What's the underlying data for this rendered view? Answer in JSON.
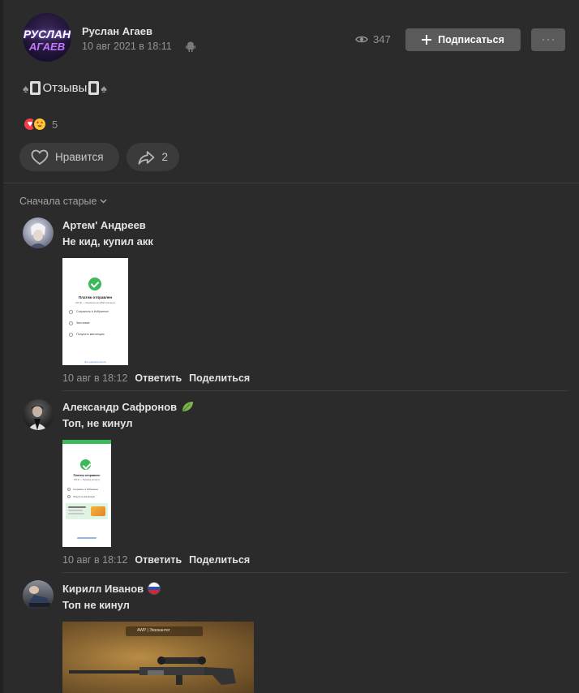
{
  "post": {
    "author": "Руслан Агаев",
    "avatar_text_top": "РУСЛАН",
    "avatar_text_bottom": "АГАЕВ",
    "date": "10 авг 2021 в 18:11",
    "views": "347",
    "subscribe_label": "Подписаться",
    "text": "Отзывы",
    "reaction_count": "5",
    "like_label": "Нравится",
    "share_count": "2"
  },
  "sort": {
    "label": "Сначала старые"
  },
  "comments": [
    {
      "author": "Артем' Андреев",
      "text": "Не кид, купил акк",
      "time": "10 авг в 18:12",
      "reply_label": "Ответить",
      "share_label": "Поделиться",
      "shot_title": "Платеж отправлен",
      "shot_subtitle": "215 ₽ — Перевод на QIWI Кошелек",
      "shot_items": [
        "Сохранить в Избранное",
        "Заготовка",
        "Получить квитанцию"
      ],
      "shot_footer": "Это сделали Антон"
    },
    {
      "author": "Александр Сафронов",
      "text": "Топ, не кинул",
      "time": "10 авг в 18:12",
      "reply_label": "Ответить",
      "share_label": "Поделиться",
      "shot_title": "Платеж отправлен",
      "shot_subtitle": "300 ₽ — Перевод на карту",
      "shot_items": [
        "Сохранить в Избранное",
        "Получить квитанцию"
      ]
    },
    {
      "author": "Кирилл Иванов",
      "text": "Топ не кинул",
      "shot_caption": "AWP | Экзокантег"
    }
  ],
  "colors": {
    "background": "#222222",
    "card": "#2b2b2b",
    "button": "#5a5a5a",
    "pill": "#3b3b3b",
    "muted_text": "#939393",
    "text": "#e1e3e6",
    "heart": "#f23c4a",
    "check_green": "#3cb95a"
  },
  "icons": {
    "views": "eye-icon",
    "platform": "android-icon",
    "like": "heart-outline-icon",
    "share": "share-arrow-icon",
    "more": "more-dots-icon",
    "sort": "chevron-down-icon",
    "badge_2": "leaf-icon",
    "badge_3": "russia-flag-icon"
  }
}
